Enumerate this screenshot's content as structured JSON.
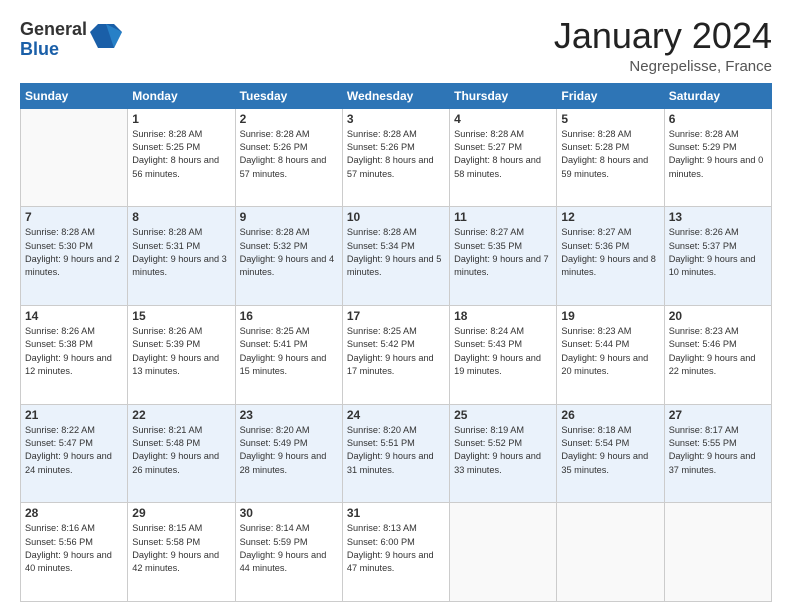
{
  "logo": {
    "general": "General",
    "blue": "Blue"
  },
  "header": {
    "month": "January 2024",
    "location": "Negrepelisse, France"
  },
  "weekdays": [
    "Sunday",
    "Monday",
    "Tuesday",
    "Wednesday",
    "Thursday",
    "Friday",
    "Saturday"
  ],
  "rows": [
    [
      {
        "day": "",
        "sunrise": "",
        "sunset": "",
        "daylight": ""
      },
      {
        "day": "1",
        "sunrise": "Sunrise: 8:28 AM",
        "sunset": "Sunset: 5:25 PM",
        "daylight": "Daylight: 8 hours and 56 minutes."
      },
      {
        "day": "2",
        "sunrise": "Sunrise: 8:28 AM",
        "sunset": "Sunset: 5:26 PM",
        "daylight": "Daylight: 8 hours and 57 minutes."
      },
      {
        "day": "3",
        "sunrise": "Sunrise: 8:28 AM",
        "sunset": "Sunset: 5:26 PM",
        "daylight": "Daylight: 8 hours and 57 minutes."
      },
      {
        "day": "4",
        "sunrise": "Sunrise: 8:28 AM",
        "sunset": "Sunset: 5:27 PM",
        "daylight": "Daylight: 8 hours and 58 minutes."
      },
      {
        "day": "5",
        "sunrise": "Sunrise: 8:28 AM",
        "sunset": "Sunset: 5:28 PM",
        "daylight": "Daylight: 8 hours and 59 minutes."
      },
      {
        "day": "6",
        "sunrise": "Sunrise: 8:28 AM",
        "sunset": "Sunset: 5:29 PM",
        "daylight": "Daylight: 9 hours and 0 minutes."
      }
    ],
    [
      {
        "day": "7",
        "sunrise": "Sunrise: 8:28 AM",
        "sunset": "Sunset: 5:30 PM",
        "daylight": "Daylight: 9 hours and 2 minutes."
      },
      {
        "day": "8",
        "sunrise": "Sunrise: 8:28 AM",
        "sunset": "Sunset: 5:31 PM",
        "daylight": "Daylight: 9 hours and 3 minutes."
      },
      {
        "day": "9",
        "sunrise": "Sunrise: 8:28 AM",
        "sunset": "Sunset: 5:32 PM",
        "daylight": "Daylight: 9 hours and 4 minutes."
      },
      {
        "day": "10",
        "sunrise": "Sunrise: 8:28 AM",
        "sunset": "Sunset: 5:34 PM",
        "daylight": "Daylight: 9 hours and 5 minutes."
      },
      {
        "day": "11",
        "sunrise": "Sunrise: 8:27 AM",
        "sunset": "Sunset: 5:35 PM",
        "daylight": "Daylight: 9 hours and 7 minutes."
      },
      {
        "day": "12",
        "sunrise": "Sunrise: 8:27 AM",
        "sunset": "Sunset: 5:36 PM",
        "daylight": "Daylight: 9 hours and 8 minutes."
      },
      {
        "day": "13",
        "sunrise": "Sunrise: 8:26 AM",
        "sunset": "Sunset: 5:37 PM",
        "daylight": "Daylight: 9 hours and 10 minutes."
      }
    ],
    [
      {
        "day": "14",
        "sunrise": "Sunrise: 8:26 AM",
        "sunset": "Sunset: 5:38 PM",
        "daylight": "Daylight: 9 hours and 12 minutes."
      },
      {
        "day": "15",
        "sunrise": "Sunrise: 8:26 AM",
        "sunset": "Sunset: 5:39 PM",
        "daylight": "Daylight: 9 hours and 13 minutes."
      },
      {
        "day": "16",
        "sunrise": "Sunrise: 8:25 AM",
        "sunset": "Sunset: 5:41 PM",
        "daylight": "Daylight: 9 hours and 15 minutes."
      },
      {
        "day": "17",
        "sunrise": "Sunrise: 8:25 AM",
        "sunset": "Sunset: 5:42 PM",
        "daylight": "Daylight: 9 hours and 17 minutes."
      },
      {
        "day": "18",
        "sunrise": "Sunrise: 8:24 AM",
        "sunset": "Sunset: 5:43 PM",
        "daylight": "Daylight: 9 hours and 19 minutes."
      },
      {
        "day": "19",
        "sunrise": "Sunrise: 8:23 AM",
        "sunset": "Sunset: 5:44 PM",
        "daylight": "Daylight: 9 hours and 20 minutes."
      },
      {
        "day": "20",
        "sunrise": "Sunrise: 8:23 AM",
        "sunset": "Sunset: 5:46 PM",
        "daylight": "Daylight: 9 hours and 22 minutes."
      }
    ],
    [
      {
        "day": "21",
        "sunrise": "Sunrise: 8:22 AM",
        "sunset": "Sunset: 5:47 PM",
        "daylight": "Daylight: 9 hours and 24 minutes."
      },
      {
        "day": "22",
        "sunrise": "Sunrise: 8:21 AM",
        "sunset": "Sunset: 5:48 PM",
        "daylight": "Daylight: 9 hours and 26 minutes."
      },
      {
        "day": "23",
        "sunrise": "Sunrise: 8:20 AM",
        "sunset": "Sunset: 5:49 PM",
        "daylight": "Daylight: 9 hours and 28 minutes."
      },
      {
        "day": "24",
        "sunrise": "Sunrise: 8:20 AM",
        "sunset": "Sunset: 5:51 PM",
        "daylight": "Daylight: 9 hours and 31 minutes."
      },
      {
        "day": "25",
        "sunrise": "Sunrise: 8:19 AM",
        "sunset": "Sunset: 5:52 PM",
        "daylight": "Daylight: 9 hours and 33 minutes."
      },
      {
        "day": "26",
        "sunrise": "Sunrise: 8:18 AM",
        "sunset": "Sunset: 5:54 PM",
        "daylight": "Daylight: 9 hours and 35 minutes."
      },
      {
        "day": "27",
        "sunrise": "Sunrise: 8:17 AM",
        "sunset": "Sunset: 5:55 PM",
        "daylight": "Daylight: 9 hours and 37 minutes."
      }
    ],
    [
      {
        "day": "28",
        "sunrise": "Sunrise: 8:16 AM",
        "sunset": "Sunset: 5:56 PM",
        "daylight": "Daylight: 9 hours and 40 minutes."
      },
      {
        "day": "29",
        "sunrise": "Sunrise: 8:15 AM",
        "sunset": "Sunset: 5:58 PM",
        "daylight": "Daylight: 9 hours and 42 minutes."
      },
      {
        "day": "30",
        "sunrise": "Sunrise: 8:14 AM",
        "sunset": "Sunset: 5:59 PM",
        "daylight": "Daylight: 9 hours and 44 minutes."
      },
      {
        "day": "31",
        "sunrise": "Sunrise: 8:13 AM",
        "sunset": "Sunset: 6:00 PM",
        "daylight": "Daylight: 9 hours and 47 minutes."
      },
      {
        "day": "",
        "sunrise": "",
        "sunset": "",
        "daylight": ""
      },
      {
        "day": "",
        "sunrise": "",
        "sunset": "",
        "daylight": ""
      },
      {
        "day": "",
        "sunrise": "",
        "sunset": "",
        "daylight": ""
      }
    ]
  ]
}
